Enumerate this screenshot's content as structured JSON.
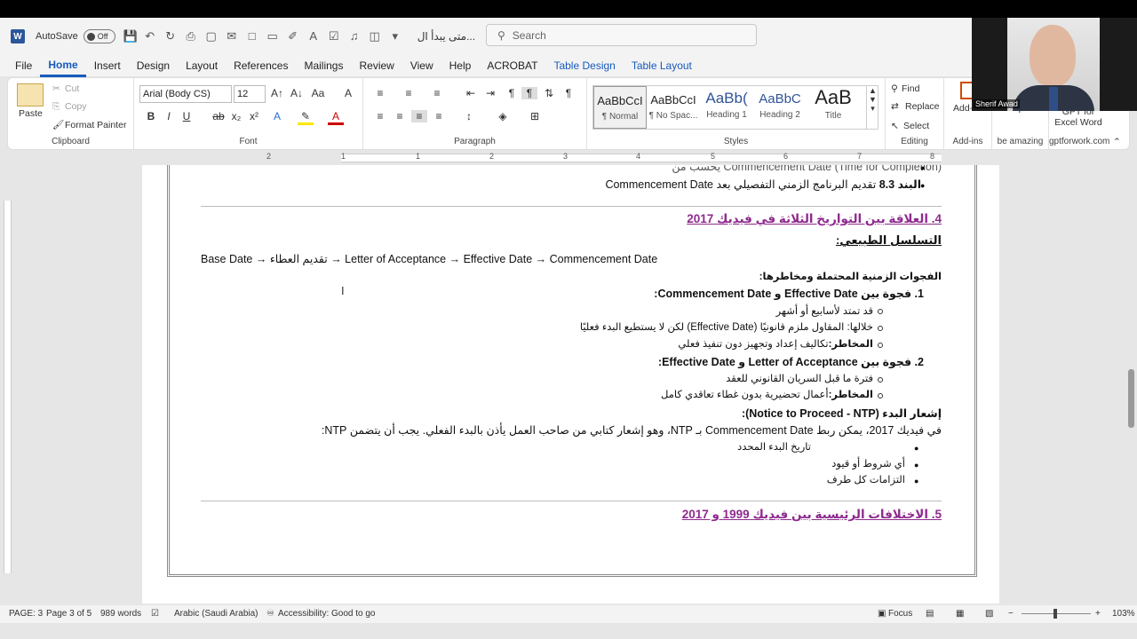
{
  "qat": {
    "autosave_label": "AutoSave",
    "autosave_state": "Off",
    "doc_name": "متى يبدأ ال..."
  },
  "search": {
    "placeholder": "Search"
  },
  "menu": {
    "file": "File",
    "home": "Home",
    "insert": "Insert",
    "design": "Design",
    "layout": "Layout",
    "references": "References",
    "mailings": "Mailings",
    "review": "Review",
    "view": "View",
    "help": "Help",
    "acrobat": "ACROBAT",
    "table_design": "Table Design",
    "table_layout": "Table Layout"
  },
  "ribbon": {
    "clipboard": {
      "paste": "Paste",
      "cut": "Cut",
      "copy": "Copy",
      "format_painter": "Format Painter",
      "label": "Clipboard"
    },
    "font": {
      "family": "Arial (Body CS)",
      "size": "12",
      "label": "Font"
    },
    "paragraph": {
      "label": "Paragraph"
    },
    "styles": {
      "label": "Styles",
      "items": [
        {
          "preview": "AaBbCcI",
          "name": "¶ Normal"
        },
        {
          "preview": "AaBbCcI",
          "name": "¶ No Spac..."
        },
        {
          "preview": "AaBb(",
          "name": "Heading 1"
        },
        {
          "preview": "AaBbC",
          "name": "Heading 2"
        },
        {
          "preview": "AaB",
          "name": "Title"
        }
      ]
    },
    "editing": {
      "find": "Find",
      "replace": "Replace",
      "select": "Select",
      "label": "Editing"
    },
    "addins": {
      "addins": "Add-ins",
      "label": "Add-ins"
    },
    "autopilot": {
      "name": "Autopilot",
      "label": "be amazing"
    },
    "gpt": {
      "name": "GPT for Excel Word",
      "label": "gptforwork.com"
    }
  },
  "webcam": {
    "caption": "Sherif Awad"
  },
  "ruler": {
    "numbers": [
      "2",
      "1",
      "1",
      "2",
      "3",
      "4",
      "5",
      "6",
      "7",
      "8"
    ]
  },
  "doc": {
    "l1": "Commencement Date (Time for Completion) يحسب من",
    "l2_label": "البند 8.3",
    "l2_text": "تقديم البرنامج الزمني التفصيلي بعد Commencement Date",
    "h4": "4. العلاقة بين التواريخ الثلاثة في فيديك 2017",
    "seq_title": "التسلسل الطبيعي:",
    "seq": "Base Date → تقديم العطاء → Letter of Acceptance → Effective Date → Commencement Date",
    "gaps_title": "الفجوات الزمنية المحتملة ومخاطرها:",
    "gap1": "1.  فجوة بين Effective Date و Commencement Date:",
    "gap1_a": "قد تمتد لأسابيع أو أشهر",
    "gap1_b": "خلالها: المقاول ملزم قانونيًا (Effective Date) لكن لا يستطيع البدء فعليًا",
    "gap1_c_label": "المخاطر:",
    "gap1_c": "تكاليف إعداد وتجهيز دون تنفيذ فعلي",
    "gap2": "2.  فجوة بين Letter of Acceptance و Effective Date:",
    "gap2_a": "فترة ما قبل السريان القانوني للعقد",
    "gap2_b_label": "المخاطر:",
    "gap2_b": "أعمال تحضيرية بدون غطاء تعاقدي كامل",
    "ntp_title": "إشعار البدء (Notice to Proceed - NTP):",
    "ntp_text": "في فيديك 2017، يمكن ربط Commencement Date بـ NTP، وهو إشعار كتابي من صاحب العمل يأذن بالبدء الفعلي. يجب أن يتضمن NTP:",
    "ntp_1": "تاريخ البدء المحدد",
    "ntp_2": "أي شروط أو قيود",
    "ntp_3": "التزامات كل طرف",
    "h5": "5. الاختلافات الرئيسية بين فيديك 1999 و 2017"
  },
  "status": {
    "page": "PAGE: 3",
    "page_of": "Page 3 of 5",
    "words": "989 words",
    "language": "Arabic (Saudi Arabia)",
    "accessibility": "Accessibility: Good to go",
    "focus": "Focus",
    "zoom": "103%"
  }
}
